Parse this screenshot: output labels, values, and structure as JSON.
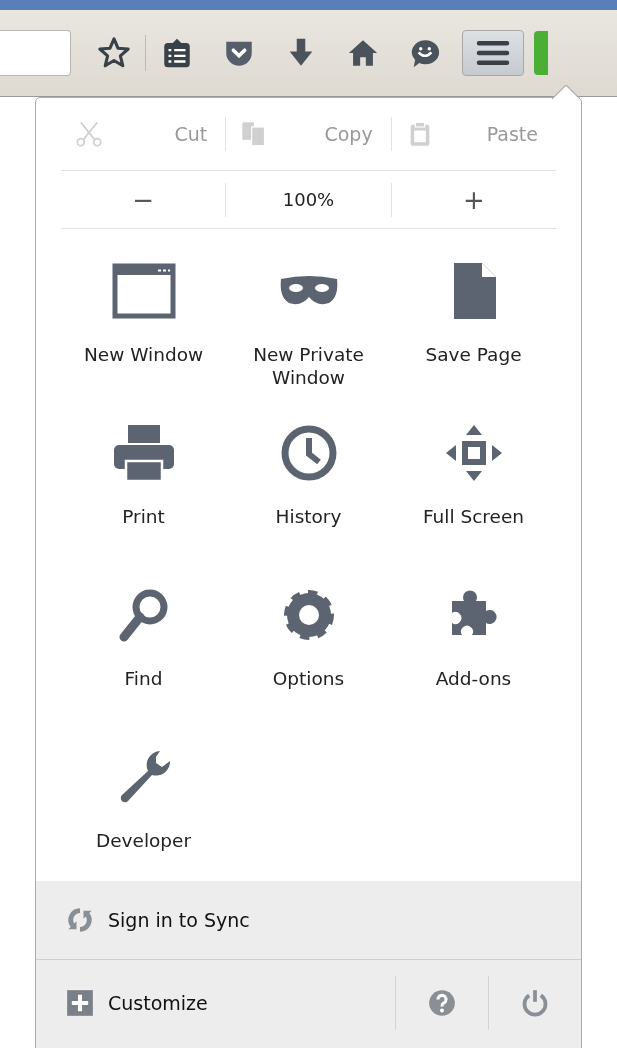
{
  "toolbar": {
    "buttons": [
      {
        "kind": "star"
      },
      {
        "kind": "reading"
      },
      {
        "kind": "pocket"
      },
      {
        "kind": "download"
      },
      {
        "kind": "home"
      },
      {
        "kind": "chat"
      }
    ],
    "menu_button": {
      "pressed": true
    }
  },
  "edit_row": [
    {
      "label": "Cut",
      "disabled": true
    },
    {
      "label": "Copy",
      "disabled": true
    },
    {
      "label": "Paste",
      "disabled": true
    }
  ],
  "zoom_row": {
    "minus": "−",
    "level": "100%",
    "plus": "+"
  },
  "items": [
    {
      "label": "New Window"
    },
    {
      "label": "New Private Window"
    },
    {
      "label": "Save Page"
    },
    {
      "label": "Print"
    },
    {
      "label": "History"
    },
    {
      "label": "Full Screen"
    },
    {
      "label": "Find"
    },
    {
      "label": "Options"
    },
    {
      "label": "Add-ons"
    },
    {
      "label": "Developer"
    }
  ],
  "sync": {
    "label": "Sign in to Sync"
  },
  "footer": {
    "customize": "Customize"
  }
}
